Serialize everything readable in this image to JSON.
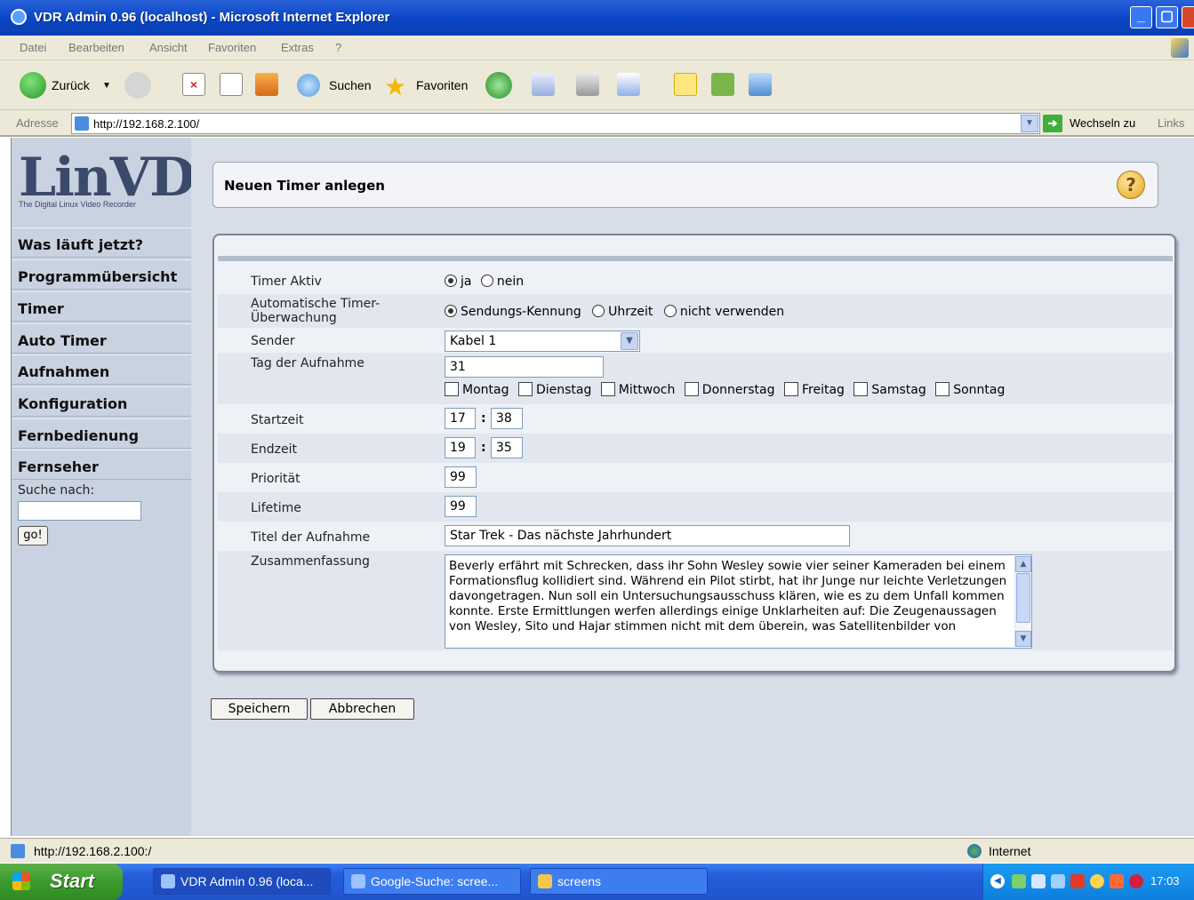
{
  "window": {
    "title": "VDR Admin 0.96 (localhost) - Microsoft Internet Explorer",
    "minimize": "_",
    "maximize": "▢"
  },
  "menu": [
    "Datei",
    "Bearbeiten",
    "Ansicht",
    "Favoriten",
    "Extras",
    "?"
  ],
  "toolbar": {
    "back_label": "Zurück",
    "search_label": "Suchen",
    "favorites_label": "Favoriten"
  },
  "address": {
    "label": "Adresse",
    "url": "http://192.168.2.100/",
    "go_label": "Wechseln zu",
    "links_label": "Links"
  },
  "logo": {
    "text": "LinVDR",
    "tagline": "The Digital Linux Video Recorder"
  },
  "nav": [
    "Was läuft jetzt?",
    "Programmübersicht",
    "Timer",
    "Auto Timer",
    "Aufnahmen",
    "Konfiguration",
    "Fernbedienung",
    "Fernseher"
  ],
  "search": {
    "label": "Suche nach:",
    "value": "",
    "button": "go!"
  },
  "page": {
    "title": "Neuen Timer anlegen",
    "help": "?"
  },
  "form": {
    "timer_aktiv": {
      "label": "Timer Aktiv",
      "options": [
        "ja",
        "nein"
      ],
      "selected": "ja"
    },
    "ueberwachung": {
      "label": "Automatische Timer-Überwachung",
      "options": [
        "Sendungs-Kennung",
        "Uhrzeit",
        "nicht verwenden"
      ],
      "selected": "Sendungs-Kennung"
    },
    "sender": {
      "label": "Sender",
      "value": "Kabel 1"
    },
    "tag": {
      "label": "Tag der Aufnahme",
      "value": "31",
      "weekdays": [
        "Montag",
        "Dienstag",
        "Mittwoch",
        "Donnerstag",
        "Freitag",
        "Samstag",
        "Sonntag"
      ]
    },
    "startzeit": {
      "label": "Startzeit",
      "hour": "17",
      "minute": "38",
      "sep": ":"
    },
    "endzeit": {
      "label": "Endzeit",
      "hour": "19",
      "minute": "35",
      "sep": ":"
    },
    "prioritaet": {
      "label": "Priorität",
      "value": "99"
    },
    "lifetime": {
      "label": "Lifetime",
      "value": "99"
    },
    "titel": {
      "label": "Titel der Aufnahme",
      "value": "Star Trek - Das nächste Jahrhundert"
    },
    "zusammenfassung": {
      "label": "Zusammenfassung",
      "value": "Beverly erfährt mit Schrecken, dass ihr Sohn Wesley sowie vier seiner Kameraden bei einem Formationsflug kollidiert sind. Während ein Pilot stirbt, hat ihr Junge nur leichte Verletzungen davongetragen. Nun soll ein Untersuchungsausschuss klären, wie es zu dem Unfall kommen konnte. Erste Ermittlungen werfen allerdings einige Unklarheiten auf: Die Zeugenaussagen von Wesley, Sito und Hajar stimmen nicht mit dem überein, was Satellitenbilder von"
    }
  },
  "buttons": {
    "save": "Speichern",
    "cancel": "Abbrechen"
  },
  "status": {
    "url": "http://192.168.2.100:/",
    "zone": "Internet"
  },
  "taskbar": {
    "start": "Start",
    "items": [
      "VDR Admin 0.96 (loca...",
      "Google-Suche: scree...",
      "screens"
    ],
    "clock": "17:03"
  }
}
